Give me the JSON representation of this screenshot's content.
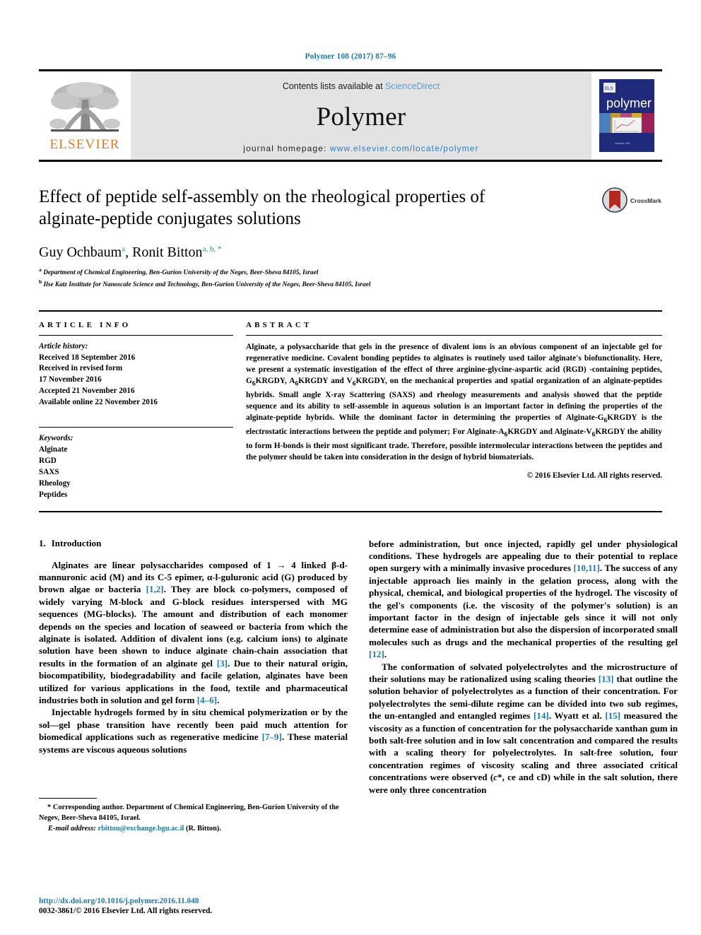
{
  "running_head": "Polymer 108 (2017) 87–96",
  "header": {
    "publisher_logo_text": "ELSEVIER",
    "contents_prefix": "Contents lists available at ",
    "contents_link": "ScienceDirect",
    "journal_title": "Polymer",
    "homepage_prefix": "journal homepage: ",
    "homepage_link": "www.elsevier.com/locate/polymer",
    "cover_title": "polymer",
    "colors": {
      "link_blue": "#1a7aad",
      "sciencedirect_blue": "#4ea3d4",
      "elsevier_orange": "#E87B1E",
      "band_gray": "#e3e3e3"
    }
  },
  "article": {
    "title": "Effect of peptide self-assembly on the rheological properties of alginate-peptide conjugates solutions",
    "authors_plain": "Guy Ochbaum a, Ronit Bitton a, b, *",
    "authors": [
      {
        "name": "Guy Ochbaum",
        "marks": "a"
      },
      {
        "name": "Ronit Bitton",
        "marks": "a, b, *"
      }
    ],
    "affiliations": [
      {
        "mark": "a",
        "text": "Department of Chemical Engineering, Ben-Gurion University of the Negev, Beer-Sheva 84105, Israel"
      },
      {
        "mark": "b",
        "text": "Ilse Katz Institute for Nanoscale Science and Technology, Ben-Gurion University of the Negev, Beer-Sheva 84105, Israel"
      }
    ],
    "crossmark_label": "CrossMark"
  },
  "article_info": {
    "heading": "ARTICLE INFO",
    "history_label": "Article history:",
    "history": [
      "Received 18 September 2016",
      "Received in revised form",
      "17 November 2016",
      "Accepted 21 November 2016",
      "Available online 22 November 2016"
    ],
    "keywords_label": "Keywords:",
    "keywords": [
      "Alginate",
      "RGD",
      "SAXS",
      "Rheology",
      "Peptides"
    ]
  },
  "abstract": {
    "heading": "ABSTRACT",
    "text": "Alginate, a polysaccharide that gels in the presence of divalent ions is an obvious component of an injectable gel for regenerative medicine. Covalent bonding peptides to alginates is routinely used tailor alginate's biofunctionality. Here, we present a systematic investigation of the effect of three arginine-glycine-aspartic acid (RGD) -containing peptides, G6KRGDY, A6KRGDY and V6KRGDY, on the mechanical properties and spatial organization of an alginate-peptides hybrids. Small angle X-ray Scattering (SAXS) and rheology measurements and analysis showed that the peptide sequence and its ability to self-assemble in aqueous solution is an important factor in defining the properties of the alginate-peptide hybrids. While the dominant factor in determining the properties of Alginate-G6KRGDY is the electrostatic interactions between the peptide and polymer; For Alginate-A6KRGDY and Alginate-V6KRGDY the ability to form H-bonds is their most significant trade. Therefore, possible intermolecular interactions between the peptides and the polymer should be taken into consideration in the design of hybrid biomaterials.",
    "copyright": "© 2016 Elsevier Ltd. All rights reserved."
  },
  "sections": {
    "introduction_number": "1.",
    "introduction_title": "Introduction"
  },
  "body": {
    "left_paragraphs": [
      "Alginates are linear polysaccharides composed of 1 → 4 linked β-d-mannuronic acid (M) and its C-5 epimer, α-l-guluronic acid (G) produced by brown algae or bacteria [1,2]. They are block co-polymers, composed of widely varying M-block and G-block residues interspersed with MG sequences (MG-blocks). The amount and distribution of each monomer depends on the species and location of seaweed or bacteria from which the alginate is isolated. Addition of divalent ions (e.g. calcium ions) to alginate solution have been shown to induce alginate chain-chain association that results in the formation of an alginate gel [3]. Due to their natural origin, biocompatibility, biodegradability and facile gelation, alginates have been utilized for various applications in the food, textile and pharmaceutical industries both in solution and gel form [4–6].",
      "Injectable hydrogels formed by in situ chemical polymerization or by the sol−gel phase transition have recently been paid much attention for biomedical applications such as regenerative medicine [7–9]. These material systems are viscous aqueous solutions"
    ],
    "right_paragraphs": [
      "before administration, but once injected, rapidly gel under physiological conditions. These hydrogels are appealing due to their potential to replace open surgery with a minimally invasive procedures [10,11]. The success of any injectable approach lies mainly in the gelation process, along with the physical, chemical, and biological properties of the hydrogel. The viscosity of the gel's components (i.e. the viscosity of the polymer's solution) is an important factor in the design of injectable gels since it will not only determine ease of administration but also the dispersion of incorporated small molecules such as drugs and the mechanical properties of the resulting gel [12].",
      "The conformation of solvated polyelectrolytes and the microstructure of their solutions may be rationalized using scaling theories [13] that outline the solution behavior of polyelectrolytes as a function of their concentration. For polyelectrolytes the semi-dilute regime can be divided into two sub regimes, the un-entangled and entangled regimes [14]. Wyatt et al. [15] measured the viscosity as a function of concentration for the polysaccharide xanthan gum in both salt-free solution and in low salt concentration and compared the results with a scaling theory for polyelectrolytes. In salt-free solution, four concentration regimes of viscosity scaling and three associated critical concentrations were observed (c*, ce and cD) while in the salt solution, there were only three concentration"
    ]
  },
  "footnote": {
    "star": "*",
    "corresponding": "Corresponding author. Department of Chemical Engineering, Ben-Gurion University of the Negev, Beer-Sheva 84105, Israel.",
    "email_label": "E-mail address:",
    "email": "rbitton@exchange.bgu.ac.il",
    "email_owner": "(R. Bitton)."
  },
  "footer": {
    "doi": "http://dx.doi.org/10.1016/j.polymer.2016.11.048",
    "issn": "0032-3861/© 2016 Elsevier Ltd. All rights reserved."
  }
}
